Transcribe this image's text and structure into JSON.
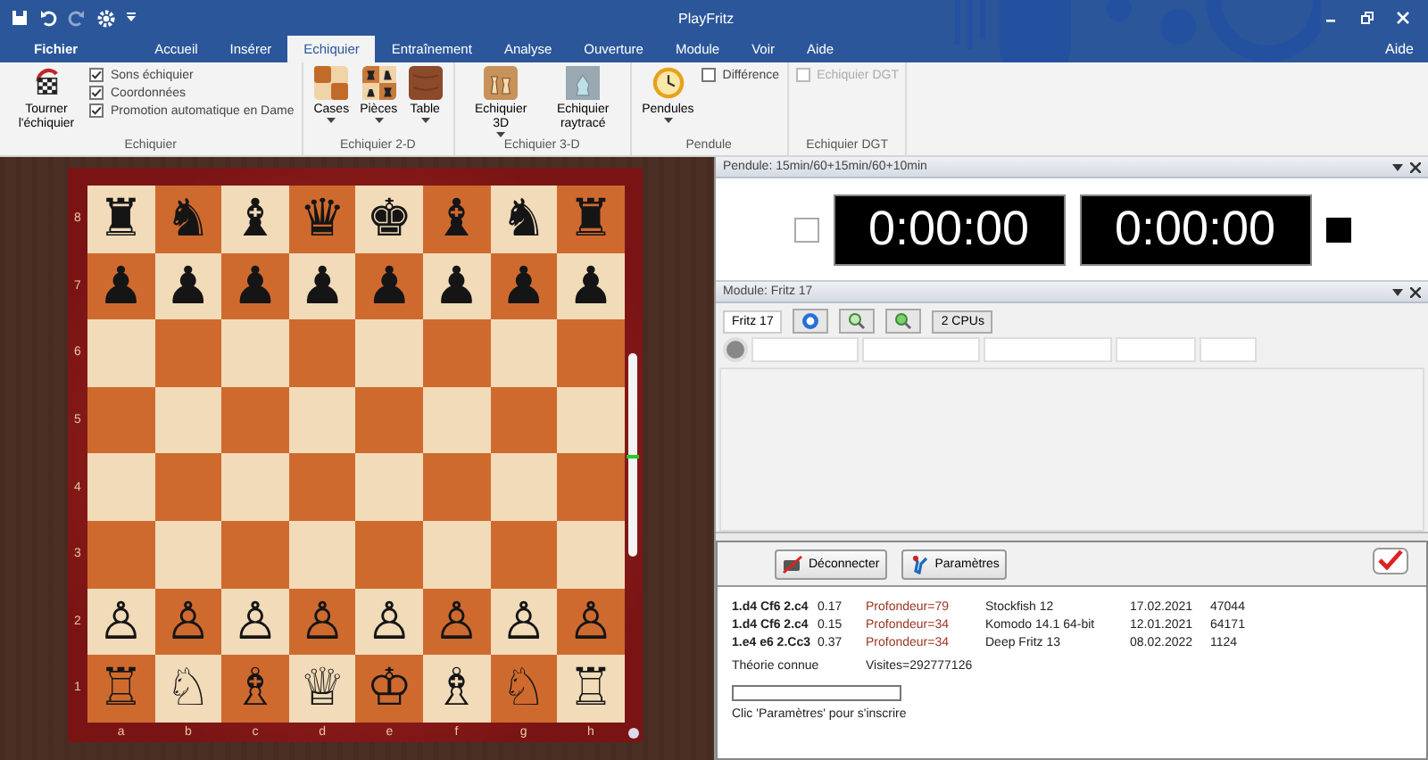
{
  "window": {
    "title": "PlayFritz",
    "help": "Aide"
  },
  "menu_tabs": [
    {
      "label": "Fichier",
      "kind": "file",
      "selected": false
    },
    {
      "label": "Accueil",
      "kind": "tab",
      "selected": false
    },
    {
      "label": "Insérer",
      "kind": "tab",
      "selected": false
    },
    {
      "label": "Echiquier",
      "kind": "tab",
      "selected": true
    },
    {
      "label": "Entraînement",
      "kind": "tab",
      "selected": false
    },
    {
      "label": "Analyse",
      "kind": "tab",
      "selected": false
    },
    {
      "label": "Ouverture",
      "kind": "tab",
      "selected": false
    },
    {
      "label": "Module",
      "kind": "tab",
      "selected": false
    },
    {
      "label": "Voir",
      "kind": "tab",
      "selected": false
    },
    {
      "label": "Aide",
      "kind": "tab",
      "selected": false
    }
  ],
  "ribbon_groups": [
    {
      "title": "Echiquier",
      "items": [
        {
          "kind": "large",
          "label": "Tourner l'échiquier",
          "dropdown": false
        },
        {
          "kind": "checks",
          "checks": [
            {
              "label": "Sons échiquier",
              "checked": true,
              "disabled": false
            },
            {
              "label": "Coordonnées",
              "checked": true,
              "disabled": false
            },
            {
              "label": "Promotion automatique en Dame",
              "checked": true,
              "disabled": false
            }
          ]
        }
      ]
    },
    {
      "title": "Echiquier 2-D",
      "items": [
        {
          "kind": "large",
          "label": "Cases",
          "dropdown": true
        },
        {
          "kind": "large",
          "label": "Pièces",
          "dropdown": true
        },
        {
          "kind": "large",
          "label": "Table",
          "dropdown": true
        }
      ]
    },
    {
      "title": "Echiquier 3-D",
      "items": [
        {
          "kind": "large",
          "label": "Echiquier 3D",
          "dropdown": true
        },
        {
          "kind": "large",
          "label": "Echiquier raytracé",
          "dropdown": false
        }
      ]
    },
    {
      "title": "Pendule",
      "items": [
        {
          "kind": "large",
          "label": "Pendules",
          "dropdown": true
        },
        {
          "kind": "checks",
          "checks": [
            {
              "label": "Différence",
              "checked": false,
              "disabled": false
            }
          ]
        }
      ]
    },
    {
      "title": "Echiquier DGT",
      "items": [
        {
          "kind": "checks",
          "checks": [
            {
              "label": "Echiquier DGT",
              "checked": false,
              "disabled": true
            }
          ]
        }
      ]
    }
  ],
  "board": {
    "ranks": [
      {
        "label": "8",
        "pieces": [
          "♜",
          "♞",
          "♝",
          "♛",
          "♚",
          "♝",
          "♞",
          "♜"
        ]
      },
      {
        "label": "7",
        "pieces": [
          "♟",
          "♟",
          "♟",
          "♟",
          "♟",
          "♟",
          "♟",
          "♟"
        ]
      },
      {
        "label": "6"
      },
      {
        "label": "5"
      },
      {
        "label": "4"
      },
      {
        "label": "3"
      },
      {
        "label": "2",
        "pieces": [
          "♙",
          "♙",
          "♙",
          "♙",
          "♙",
          "♙",
          "♙",
          "♙"
        ]
      },
      {
        "label": "1",
        "pieces": [
          "♖",
          "♘",
          "♗",
          "♕",
          "♔",
          "♗",
          "♘",
          "♖"
        ]
      }
    ],
    "files": [
      "a",
      "b",
      "c",
      "d",
      "e",
      "f",
      "g",
      "h"
    ],
    "size_slider": {
      "level": 0.5
    }
  },
  "clock_panel": {
    "title": "Pendule: 15min/60+15min/60+10min",
    "times": [
      "0:00:00",
      "0:00:00"
    ]
  },
  "engine_panel": {
    "title": "Module: Fritz 17",
    "engine_tab": "Fritz 17",
    "cpu_button": "2 CPUs"
  },
  "book_panel": {
    "buttons": [
      "Déconnecter",
      "Paramètres"
    ],
    "lines": [
      {
        "moves": "1.d4 Cf6 2.c4",
        "eval": "0.17",
        "depth": "Profondeur=79",
        "engine": "Stockfish 12",
        "date": "17.02.2021",
        "games": "47044"
      },
      {
        "moves": "1.d4 Cf6 2.c4",
        "eval": "0.15",
        "depth": "Profondeur=34",
        "engine": "Komodo 14.1 64-bit",
        "date": "12.01.2021",
        "games": "64171"
      },
      {
        "moves": "1.e4 e6 2.Cc3",
        "eval": "0.37",
        "depth": "Profondeur=34",
        "engine": "Deep Fritz 13",
        "date": "08.02.2022",
        "games": "1124"
      }
    ],
    "status": "Théorie connue",
    "visits": "Visites=292777126",
    "progress": {
      "level": 0
    },
    "hint": "Clic 'Paramètres' pour s'inscrire"
  }
}
